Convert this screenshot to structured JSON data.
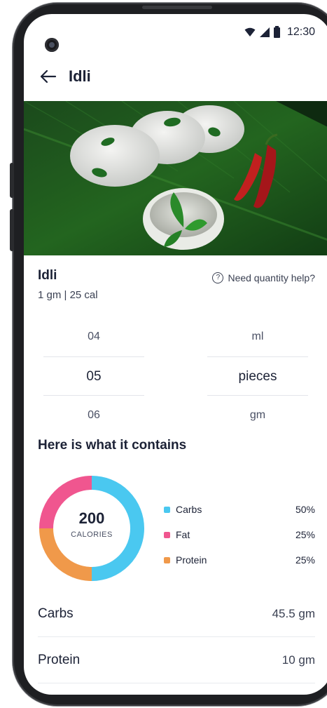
{
  "status_bar": {
    "time": "12:30"
  },
  "header": {
    "title": "Idli"
  },
  "food": {
    "name": "Idli",
    "meta": "1 gm | 25 cal",
    "help_label": "Need quantity help?"
  },
  "quantity_picker": {
    "numbers": [
      "04",
      "05",
      "06"
    ],
    "units": [
      "ml",
      "pieces",
      "gm"
    ],
    "selected_number": "05",
    "selected_unit": "pieces"
  },
  "contents": {
    "title": "Here is what it contains",
    "calories_value": "200",
    "calories_label": "CALORIES",
    "legend": [
      {
        "name": "Carbs",
        "pct": "50%",
        "value": 50,
        "color": "#4ac8f0"
      },
      {
        "name": "Fat",
        "pct": "25%",
        "value": 25,
        "color": "#f0568f"
      },
      {
        "name": "Protein",
        "pct": "25%",
        "value": 25,
        "color": "#f0994a"
      }
    ]
  },
  "nutrients": [
    {
      "name": "Carbs",
      "value": "45.5 gm"
    },
    {
      "name": "Protein",
      "value": "10 gm"
    }
  ],
  "icons": {
    "back": "arrow-left-icon",
    "help": "question-circle-icon",
    "wifi": "wifi-icon",
    "signal": "signal-icon",
    "battery": "battery-icon"
  },
  "colors": {
    "carbs": "#4ac8f0",
    "fat": "#f0568f",
    "protein": "#f0994a",
    "text_primary": "#1c2236"
  }
}
